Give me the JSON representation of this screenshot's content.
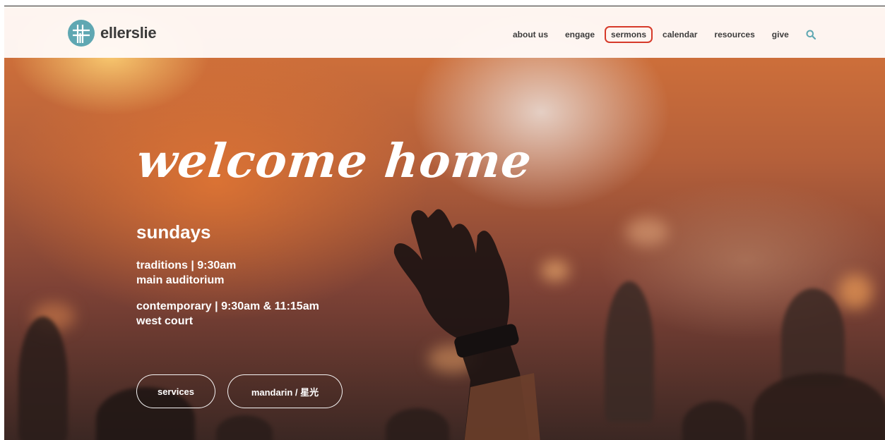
{
  "brand": {
    "name": "ellerslie",
    "accent": "#5fa7b2"
  },
  "nav": {
    "items": [
      {
        "label": "about us"
      },
      {
        "label": "engage"
      },
      {
        "label": "sermons",
        "highlighted": true
      },
      {
        "label": "calendar"
      },
      {
        "label": "resources"
      },
      {
        "label": "give"
      }
    ],
    "search_icon": "search-icon",
    "highlight_color": "#d63a2a"
  },
  "hero": {
    "headline": "welcome home",
    "schedule_title": "sundays",
    "services": [
      {
        "line1": "traditions | 9:30am",
        "line2": "main auditorium"
      },
      {
        "line1": "contemporary | 9:30am & 11:15am",
        "line2": "west court"
      }
    ],
    "buttons": [
      {
        "label": "services"
      },
      {
        "label": "mandarin / 星光"
      }
    ]
  }
}
